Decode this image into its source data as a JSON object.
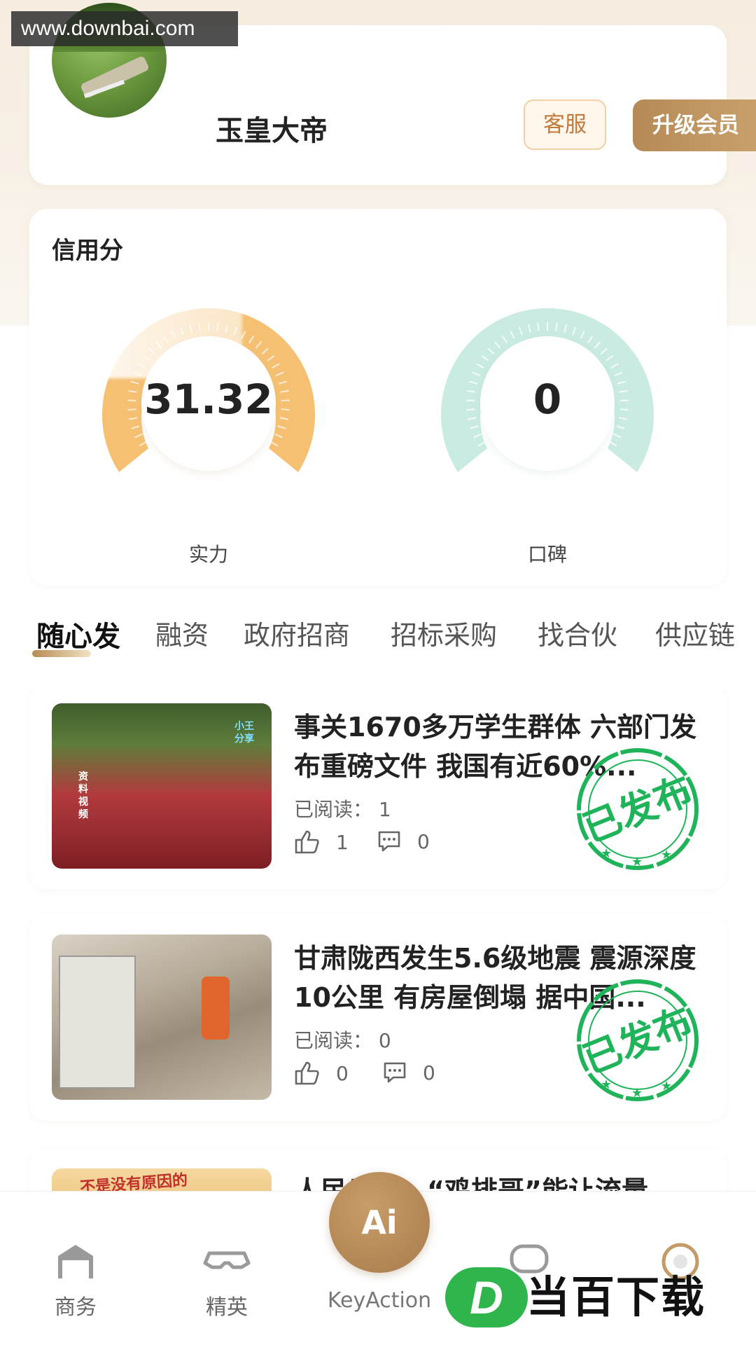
{
  "watermark": "www.downbai.com",
  "profile": {
    "user_name": "玉皇大帝",
    "service_label": "客服",
    "upgrade_label": "升级会员"
  },
  "credit": {
    "title": "信用分",
    "strength": {
      "value": "31.32",
      "label": "实力",
      "color": "#f5c072"
    },
    "reputation": {
      "value": "0",
      "label": "口碑",
      "color": "#c9ebe1"
    }
  },
  "tabs": [
    {
      "label": "随心发"
    },
    {
      "label": "融资"
    },
    {
      "label": "政府招商"
    },
    {
      "label": "招标采购"
    },
    {
      "label": "找合伙"
    },
    {
      "label": "供应链"
    }
  ],
  "news": [
    {
      "title": "事关1670多万学生群体 六部门发布重磅文件 我国有近60%...",
      "read": "已阅读：  1",
      "likes": "1",
      "comments": "0",
      "stamp": "已发布",
      "thumb_text_corner": "小王分享",
      "thumb_text_side": "资料视频"
    },
    {
      "title": "甘肃陇西发生5.6级地震 震源深度10公里 有房屋倒塌 据中国...",
      "read": "已阅读：  0",
      "likes": "0",
      "comments": "0",
      "stamp": "已发布"
    },
    {
      "title": "人民日报：“鸡排哥”能让流量",
      "thumb_text": "不是没有原因的"
    }
  ],
  "nav": {
    "business": "商务",
    "elite": "精英",
    "ai_button": "Ai",
    "ai_label": "KeyAction"
  },
  "brand": {
    "logo_letter": "D",
    "logo_text": "当百下载"
  },
  "colors": {
    "accent_gold": "#b58a56",
    "stamp_green": "#1fb35a",
    "gauge_orange": "#f5c072",
    "gauge_mint": "#c9ebe1"
  }
}
